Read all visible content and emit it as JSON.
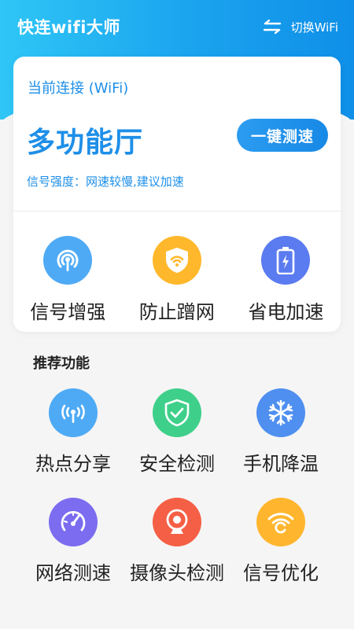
{
  "app": {
    "title": "快连wifi大师",
    "switch_label": "切换WiFi"
  },
  "connection": {
    "label": "当前连接 (WiFi)",
    "ssid": "多功能厅",
    "speed_test_button": "一键测速",
    "signal_text": "信号强度：网速较慢,建议加速"
  },
  "card_features": [
    {
      "label": "信号增强",
      "icon": "signal-boost-icon",
      "color": "#4eaaf5"
    },
    {
      "label": "防止蹭网",
      "icon": "shield-wifi-icon",
      "color": "#ffb82b"
    },
    {
      "label": "省电加速",
      "icon": "battery-icon",
      "color": "#5b7bf0"
    }
  ],
  "recommended": {
    "title": "推荐功能",
    "items": [
      {
        "label": "热点分享",
        "icon": "hotspot-icon",
        "color": "#4eaaf5"
      },
      {
        "label": "安全检测",
        "icon": "shield-check-icon",
        "color": "#3ed08a"
      },
      {
        "label": "手机降温",
        "icon": "snowflake-icon",
        "color": "#4e8ff0"
      },
      {
        "label": "网络测速",
        "icon": "speedometer-icon",
        "color": "#7b6cf0"
      },
      {
        "label": "摄像头检测",
        "icon": "camera-icon",
        "color": "#f55f45"
      },
      {
        "label": "信号优化",
        "icon": "wifi-optimize-icon",
        "color": "#ffb62e"
      }
    ]
  }
}
